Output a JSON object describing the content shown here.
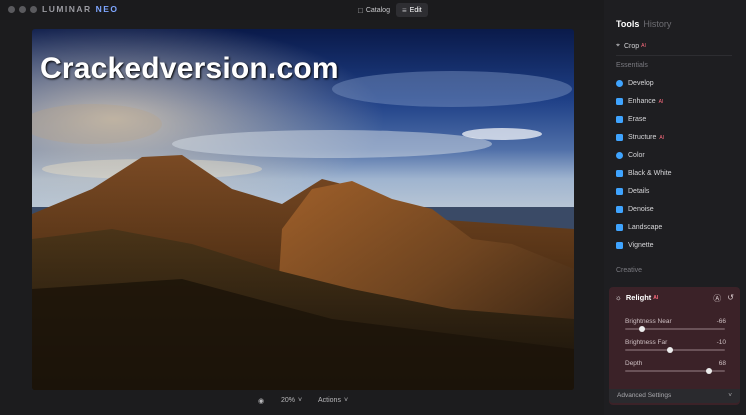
{
  "window": {
    "brand_main": "LUMINAR",
    "brand_sub": "NEO",
    "nav": [
      {
        "label": "Catalog",
        "icon": "folder-icon",
        "active": false
      },
      {
        "label": "Edit",
        "icon": "sliders-icon",
        "active": true
      }
    ]
  },
  "watermark": "Crackedversion.com",
  "bottom_bar": {
    "zoom": "20%",
    "actions_label": "Actions"
  },
  "panel": {
    "tabs": {
      "tools": "Tools",
      "history": "History"
    },
    "crop": "Crop",
    "essentials_heading": "Essentials",
    "essentials": [
      {
        "label": "Develop",
        "color": "#3fa4ff"
      },
      {
        "label": "Enhance",
        "color": "#3fa4ff",
        "ai": true
      },
      {
        "label": "Erase",
        "color": "#3fa4ff"
      },
      {
        "label": "Structure",
        "color": "#3fa4ff",
        "ai": true
      },
      {
        "label": "Color",
        "color": "#3fa4ff"
      },
      {
        "label": "Black & White",
        "color": "#3fa4ff"
      },
      {
        "label": "Details",
        "color": "#3fa4ff"
      },
      {
        "label": "Denoise",
        "color": "#3fa4ff"
      },
      {
        "label": "Landscape",
        "color": "#3fa4ff"
      },
      {
        "label": "Vignette",
        "color": "#3fa4ff"
      }
    ],
    "creative_heading": "Creative",
    "relight": {
      "title": "Relight",
      "sliders": [
        {
          "label": "Brightness Near",
          "value": "-66",
          "fraction": 0.17
        },
        {
          "label": "Brightness Far",
          "value": "-10",
          "fraction": 0.45
        },
        {
          "label": "Depth",
          "value": "68",
          "fraction": 0.84
        }
      ],
      "advanced": "Advanced Settings"
    }
  },
  "colors": {
    "accent_ai": "#ff6d7f",
    "relight_bg": "#3b2228",
    "tool_icon": "#3fa4ff"
  }
}
